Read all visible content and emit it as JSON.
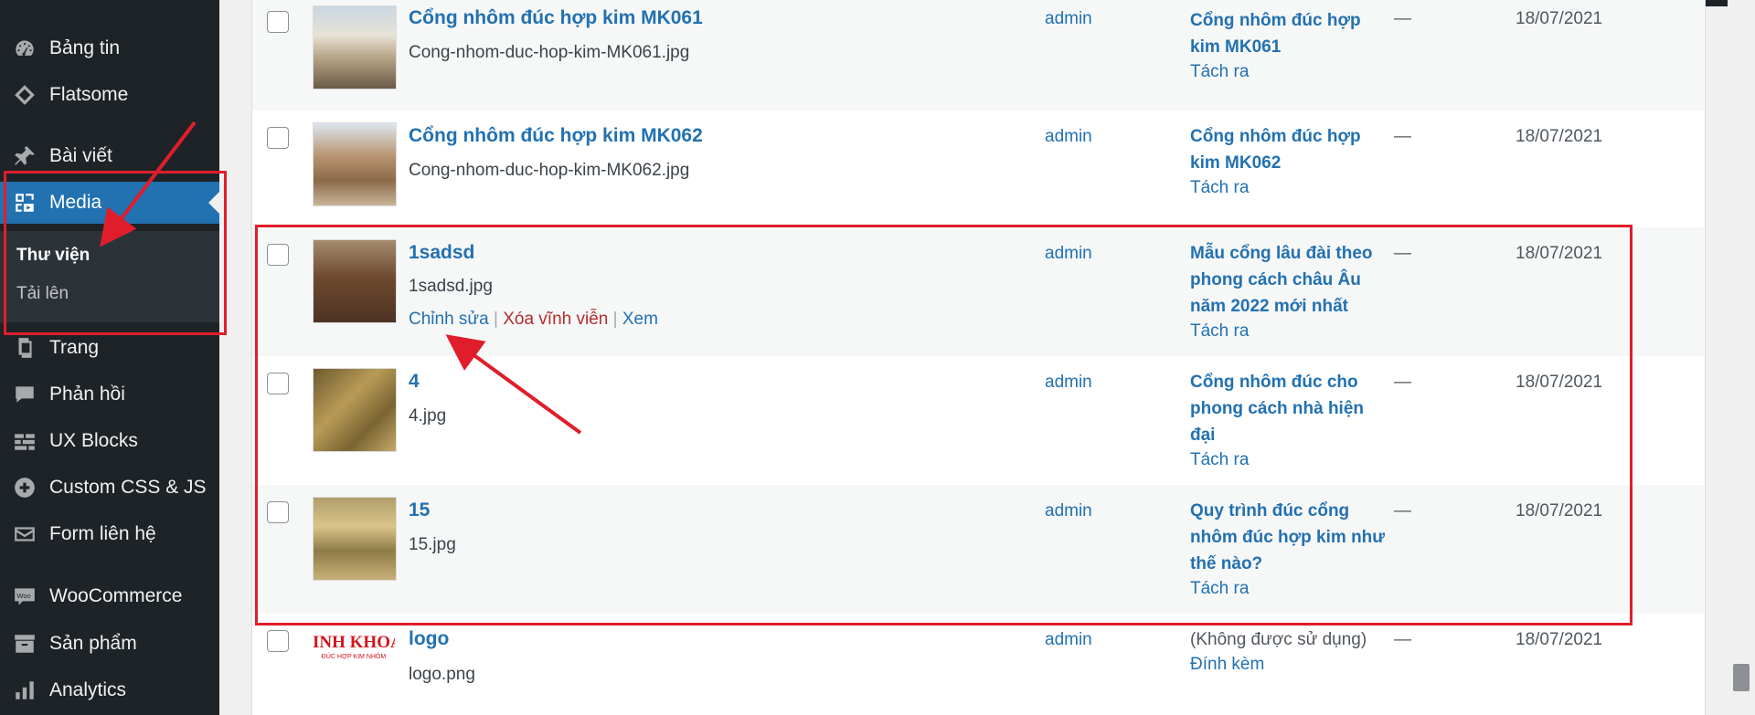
{
  "sidebar": {
    "items": [
      {
        "label": "Bảng tin",
        "icon": "dashboard-icon"
      },
      {
        "label": "Flatsome",
        "icon": "flatsome-icon"
      },
      {
        "label": "Bài viết",
        "icon": "pin-icon"
      },
      {
        "label": "Media",
        "icon": "media-icon"
      },
      {
        "label": "Trang",
        "icon": "pages-icon"
      },
      {
        "label": "Phản hồi",
        "icon": "comments-icon"
      },
      {
        "label": "UX Blocks",
        "icon": "blocks-icon"
      },
      {
        "label": "Custom CSS & JS",
        "icon": "plus-circle-icon"
      },
      {
        "label": "Form liên hệ",
        "icon": "mail-icon"
      },
      {
        "label": "WooCommerce",
        "icon": "woo-icon"
      },
      {
        "label": "Sản phẩm",
        "icon": "archive-icon"
      },
      {
        "label": "Analytics",
        "icon": "chart-bars-icon"
      }
    ],
    "media_sub": {
      "library": "Thư viện",
      "upload": "Tải lên"
    }
  },
  "rows": [
    {
      "title": "Cổng nhôm đúc hợp kim MK061",
      "file": "Cong-nhom-duc-hop-kim-MK061.jpg",
      "author": "admin",
      "uploaded_to": "Cổng nhôm đúc hợp kim MK061",
      "detach": "Tách ra",
      "comments": "—",
      "date": "18/07/2021"
    },
    {
      "title": "Cổng nhôm đúc hợp kim MK062",
      "file": "Cong-nhom-duc-hop-kim-MK062.jpg",
      "author": "admin",
      "uploaded_to": "Cổng nhôm đúc hợp kim MK062",
      "detach": "Tách ra",
      "comments": "—",
      "date": "18/07/2021"
    },
    {
      "title": "1sadsd",
      "file": "1sadsd.jpg",
      "author": "admin",
      "uploaded_to": "Mẫu cổng lâu đài theo phong cách châu Âu năm 2022 mới nhất",
      "detach": "Tách ra",
      "comments": "—",
      "date": "18/07/2021",
      "actions": {
        "edit": "Chỉnh sửa",
        "delete": "Xóa vĩnh viễn",
        "view": "Xem",
        "sep": "|"
      }
    },
    {
      "title": "4",
      "file": "4.jpg",
      "author": "admin",
      "uploaded_to": "Cổng nhôm đúc cho phong cách nhà hiện đại",
      "detach": "Tách ra",
      "comments": "—",
      "date": "18/07/2021"
    },
    {
      "title": "15",
      "file": "15.jpg",
      "author": "admin",
      "uploaded_to": "Quy trình đúc cổng nhôm đúc hợp kim như thế nào?",
      "detach": "Tách ra",
      "comments": "—",
      "date": "18/07/2021"
    },
    {
      "title": "logo",
      "file": "logo.png",
      "author": "admin",
      "uploaded_to": "(Không được sử dụng)",
      "detach": "Đính kèm",
      "comments": "—",
      "date": "18/07/2021",
      "logo_text": "INH KHOA",
      "logo_sub": "ĐÚC HỢP KIM NHÔM"
    }
  ],
  "colors": {
    "accent": "#2271b1",
    "annotation": "#e01e2b",
    "sidebar": "#1d2327"
  }
}
